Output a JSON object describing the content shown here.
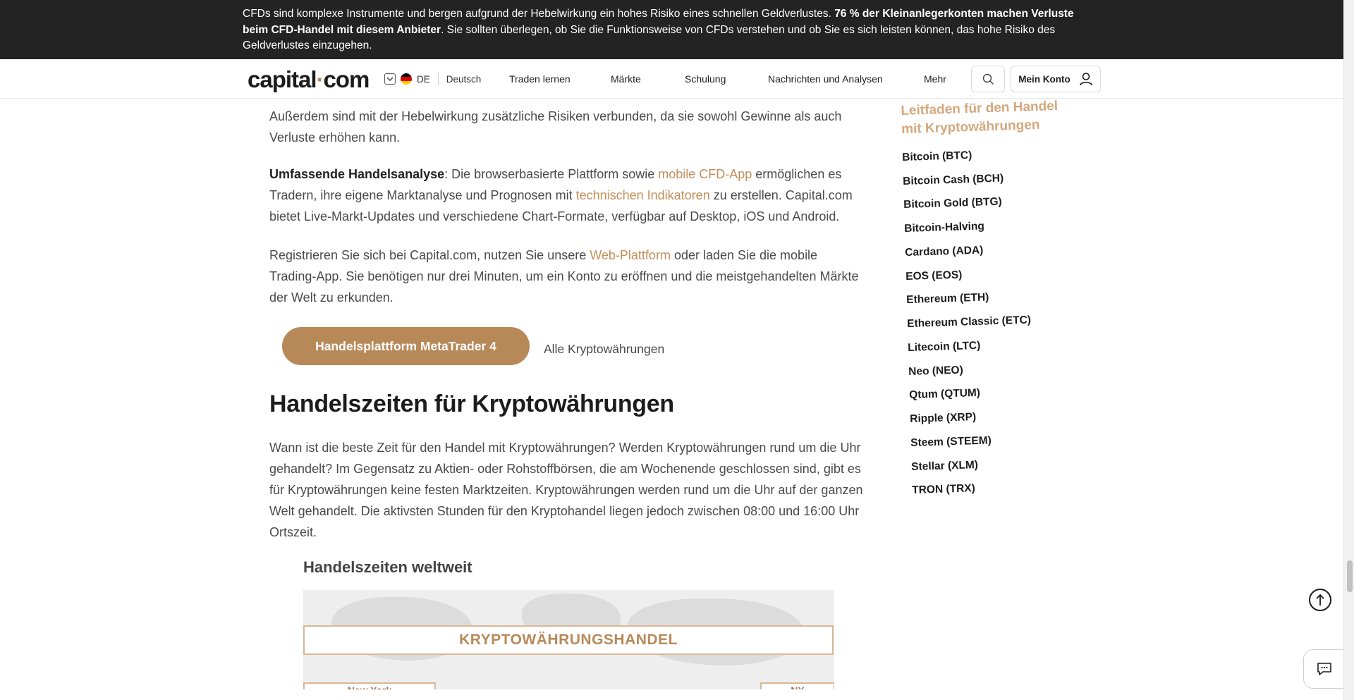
{
  "banner": {
    "text_before": "CFDs sind komplexe Instrumente und bergen aufgrund der Hebelwirkung ein hohes Risiko eines schnellen Geldverlustes. ",
    "text_bold": "76 % der Kleinanlegerkonten machen Verluste beim CFD-Handel mit diesem Anbieter",
    "text_after": ". Sie sollten überlegen, ob Sie die Funktionsweise von CFDs verstehen und ob Sie es sich leisten können, das hohe Risiko des Geldverlustes einzugehen."
  },
  "header": {
    "logo_main": "capital",
    "logo_dot": "·",
    "logo_suffix": "com",
    "lang_code": "DE",
    "lang_name": "Deutsch",
    "nav": [
      "Traden lernen",
      "Märkte",
      "Schulung",
      "Nachrichten und Analysen",
      "Mehr"
    ],
    "account_label": "Mein Konto",
    "icons": {
      "search": "search-icon",
      "user": "user-icon",
      "chevron": "chevron-down-icon",
      "flag": "germany-flag-icon"
    }
  },
  "article": {
    "para1_line1": "Außerdem sind mit der Hebelwirkung zusätzliche Risiken verbunden, da sie sowohl Gewinne als auch",
    "para1_line2": "Verluste erhöhen kann.",
    "para2": {
      "bold": "Umfassende Handelsanalyse",
      "t1": ": Die browserbasierte Plattform sowie ",
      "link1": "mobile CFD-App",
      "t2": " ermöglichen es Tradern, ihre eigene Marktanalyse und Prognosen mit ",
      "link2": "technischen Indikatoren",
      "t3": " zu erstellen. Capital.com bietet Live-Markt-Updates und verschiedene Chart-Formate, verfügbar auf Desktop, iOS und Android."
    },
    "para3": {
      "t1": "Registrieren Sie sich bei Capital.com, nutzen Sie unsere ",
      "link1": "Web-Plattform",
      "t2": " oder laden Sie die mobile Trading-App. Sie benötigen nur drei Minuten, um ein Konto zu eröffnen und die meistgehandelten Märkte der Welt zu erkunden."
    },
    "cta_label": "Handelsplattform MetaTrader 4",
    "all_crypto_label": "Alle Kryptowährungen",
    "heading": "Handelszeiten für Kryptowährungen",
    "para4": "Wann ist die beste Zeit für den Handel mit Kryptowährungen? Werden Kryptowährungen rund um die Uhr gehandelt? Im Gegensatz zu Aktien- oder Rohstoffbörsen, die am Wochenende geschlossen sind, gibt es für Kryptowährungen keine festen Marktzeiten. Kryptowährungen werden rund um die Uhr auf der ganzen Welt gehandelt. Die aktivsten Stunden für den Kryptohandel liegen jedoch zwischen 08:00 und 16:00 Uhr Ortszeit.",
    "figure": {
      "title": "Handelszeiten weltweit",
      "band": "KRYPTOWÄHRUNGSHANDEL",
      "city_left": "New York",
      "city_right": "NY"
    }
  },
  "sidebar": {
    "title": "Leitfaden für den Handel mit Kryptowährungen",
    "items": [
      "Bitcoin (BTC)",
      "Bitcoin Cash (BCH)",
      "Bitcoin Gold (BTG)",
      "Bitcoin-Halving",
      "Cardano (ADA)",
      "EOS (EOS)",
      "Ethereum (ETH)",
      "Ethereum Classic (ETC)",
      "Litecoin (LTC)",
      "Neo (NEO)",
      "Qtum (QTUM)",
      "Ripple (XRP)",
      "Steem (STEEM)",
      "Stellar (XLM)",
      "TRON (TRX)"
    ]
  },
  "colors": {
    "accent": "#b88958",
    "link": "#c38f5a",
    "banner_bg": "#232323",
    "sidebar_title": "#d4a77c"
  },
  "widgets": {
    "back_to_top_icon": "arrow-up-icon",
    "chat_icon": "chat-icon"
  }
}
